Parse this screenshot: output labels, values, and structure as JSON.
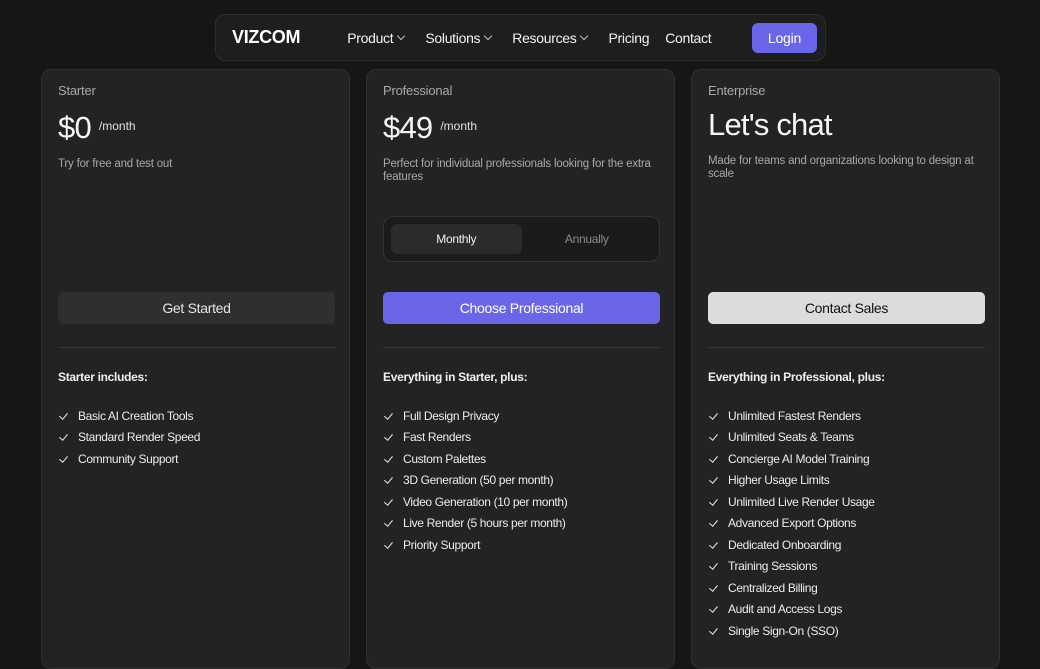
{
  "nav": {
    "logo": "VIZCOM",
    "items": [
      {
        "label": "Product",
        "dropdown": true
      },
      {
        "label": "Solutions",
        "dropdown": true
      },
      {
        "label": "Resources",
        "dropdown": true
      },
      {
        "label": "Pricing",
        "dropdown": false
      },
      {
        "label": "Contact",
        "dropdown": false
      }
    ],
    "login_label": "Login"
  },
  "plans": {
    "starter": {
      "tier": "Starter",
      "price": "$0",
      "per": "/month",
      "description": "Try for free and test out",
      "cta": "Get Started",
      "includes_title": "Starter includes:",
      "features": [
        "Basic AI Creation Tools",
        "Standard Render Speed",
        "Community Support"
      ]
    },
    "professional": {
      "tier": "Professional",
      "price": "$49",
      "per": "/month",
      "description": "Perfect for individual professionals looking for the extra features",
      "billing_toggle": {
        "monthly": "Monthly",
        "annually": "Annually",
        "selected": "Monthly"
      },
      "cta": "Choose Professional",
      "includes_title": "Everything in Starter, plus:",
      "features": [
        "Full Design Privacy",
        "Fast Renders",
        "Custom Palettes",
        "3D Generation (50 per month)",
        "Video Generation (10 per month)",
        "Live Render (5 hours per month)",
        "Priority Support"
      ]
    },
    "enterprise": {
      "tier": "Enterprise",
      "headline": "Let's chat",
      "description": "Made for teams and organizations looking to design at scale",
      "cta": "Contact Sales",
      "includes_title": "Everything in Professional, plus:",
      "features": [
        "Unlimited Fastest Renders",
        "Unlimited Seats & Teams",
        "Concierge AI Model Training",
        "Higher Usage Limits",
        "Unlimited Live Render Usage",
        "Advanced Export Options",
        "Dedicated Onboarding",
        "Training Sessions",
        "Centralized Billing",
        "Audit and Access Logs",
        "Single Sign-On (SSO)"
      ]
    }
  },
  "colors": {
    "background": "#161616",
    "card": "#232323",
    "accent": "#6a66e8",
    "light_button": "#dcdcdc"
  }
}
